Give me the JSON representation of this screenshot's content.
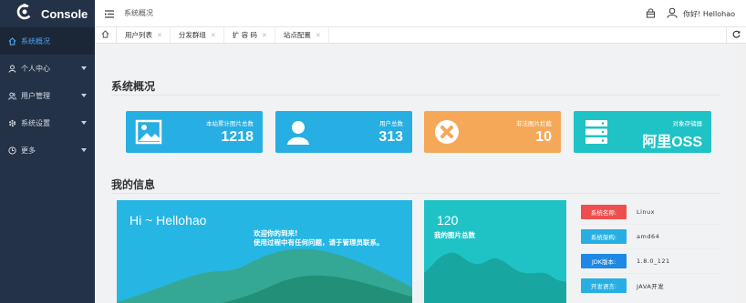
{
  "app": {
    "name": "Console"
  },
  "sidebar": {
    "items": [
      {
        "label": "系统概况",
        "icon": "home-icon",
        "active": true
      },
      {
        "label": "个人中心",
        "icon": "user-icon"
      },
      {
        "label": "用户管理",
        "icon": "users-icon"
      },
      {
        "label": "系统设置",
        "icon": "gear-icon"
      },
      {
        "label": "更多",
        "icon": "clock-icon"
      }
    ]
  },
  "header": {
    "breadcrumb": "系统概况",
    "greeting": "你好! Hellohao"
  },
  "tabs": [
    {
      "label": "用户列表"
    },
    {
      "label": "分发群组"
    },
    {
      "label": "扩 容 码"
    },
    {
      "label": "站点配置"
    }
  ],
  "overview": {
    "title": "系统概况",
    "stats": [
      {
        "label": "本站累计图片总数",
        "value": "1218",
        "color": "#27aee2",
        "icon": "image-icon"
      },
      {
        "label": "用户总数",
        "value": "313",
        "color": "#27aee2",
        "icon": "user-icon"
      },
      {
        "label": "非法图片拦截",
        "value": "10",
        "color": "#f5a857",
        "icon": "block-icon"
      },
      {
        "label": "对象存储器",
        "value": "阿里OSS",
        "color": "#1fc3c6",
        "icon": "server-icon"
      }
    ]
  },
  "my_info": {
    "title": "我的信息",
    "hello_title": "Hi ~ Hellohao",
    "welcome_line1": "欢迎你的到来!",
    "welcome_line2": "使用过程中有任何问题，请于管理员联系。",
    "pic_count": "120",
    "pic_label": "我的图片总数",
    "system": [
      {
        "key": "系统名称:",
        "value": "Linux",
        "color": "#ef4e4e"
      },
      {
        "key": "系统架构:",
        "value": "amd64",
        "color": "#27aee2"
      },
      {
        "key": "JDK版本:",
        "value": "1.8.0_121",
        "color": "#1e88e5"
      },
      {
        "key": "开发语言:",
        "value": "JAVA开发",
        "color": "#27aee2"
      }
    ]
  }
}
